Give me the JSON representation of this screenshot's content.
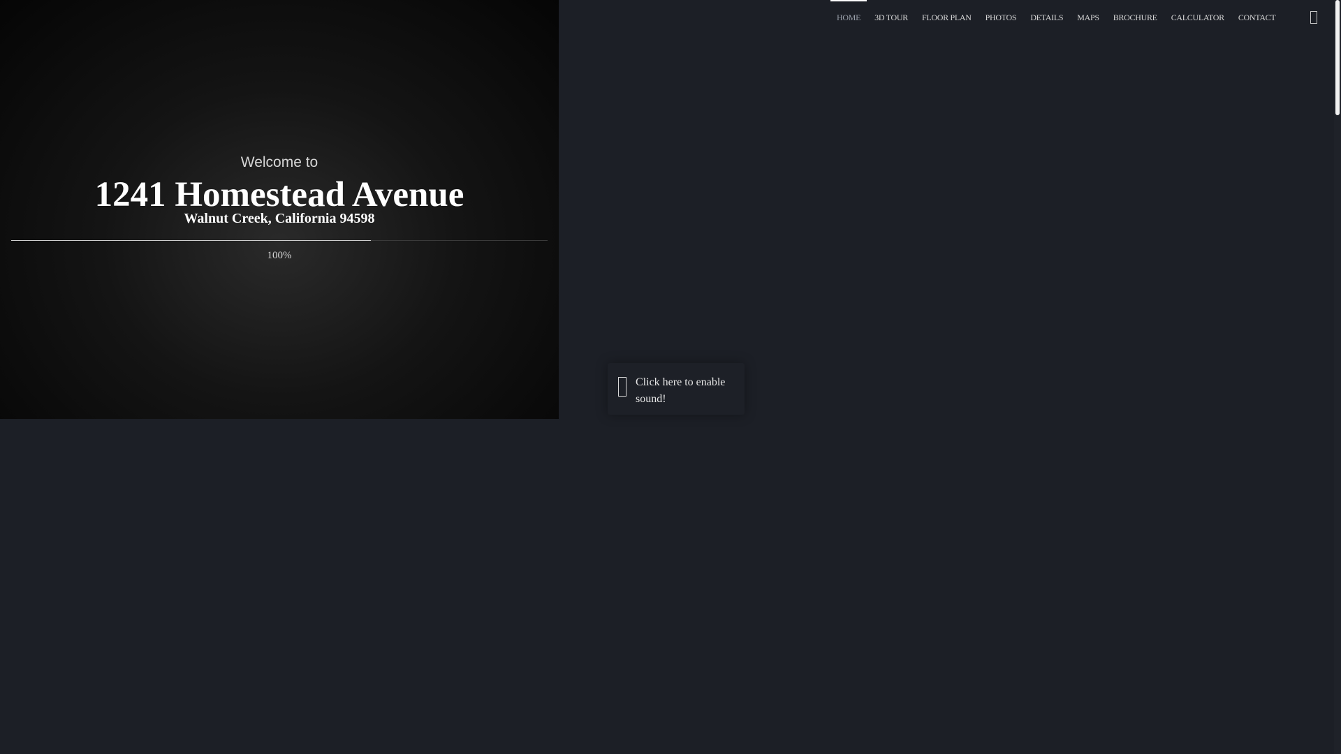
{
  "nav": {
    "items": [
      {
        "label": "HOME",
        "active": true
      },
      {
        "label": "3D TOUR",
        "active": false
      },
      {
        "label": "FLOOR PLAN",
        "active": false
      },
      {
        "label": "PHOTOS",
        "active": false
      },
      {
        "label": "DETAILS",
        "active": false
      },
      {
        "label": "MAPS",
        "active": false
      },
      {
        "label": "BROCHURE",
        "active": false
      },
      {
        "label": "CALCULATOR",
        "active": false
      },
      {
        "label": "CONTACT",
        "active": false
      }
    ],
    "menu_icon": "menu-box-icon"
  },
  "loader": {
    "welcome_text": "Welcome to",
    "title": "1241 Homestead Avenue",
    "subtitle": "Walnut Creek, California 94598",
    "progress_label": "100%",
    "progress_fill_fraction": 0.67
  },
  "sound": {
    "label": "Click here to enable sound!",
    "icon": "speaker-icon"
  },
  "colors": {
    "page_background": "#1c1f26",
    "accent_white": "#ffffff",
    "nav_text": "#d8d8d8",
    "nav_active_text": "#9aa0aa"
  }
}
